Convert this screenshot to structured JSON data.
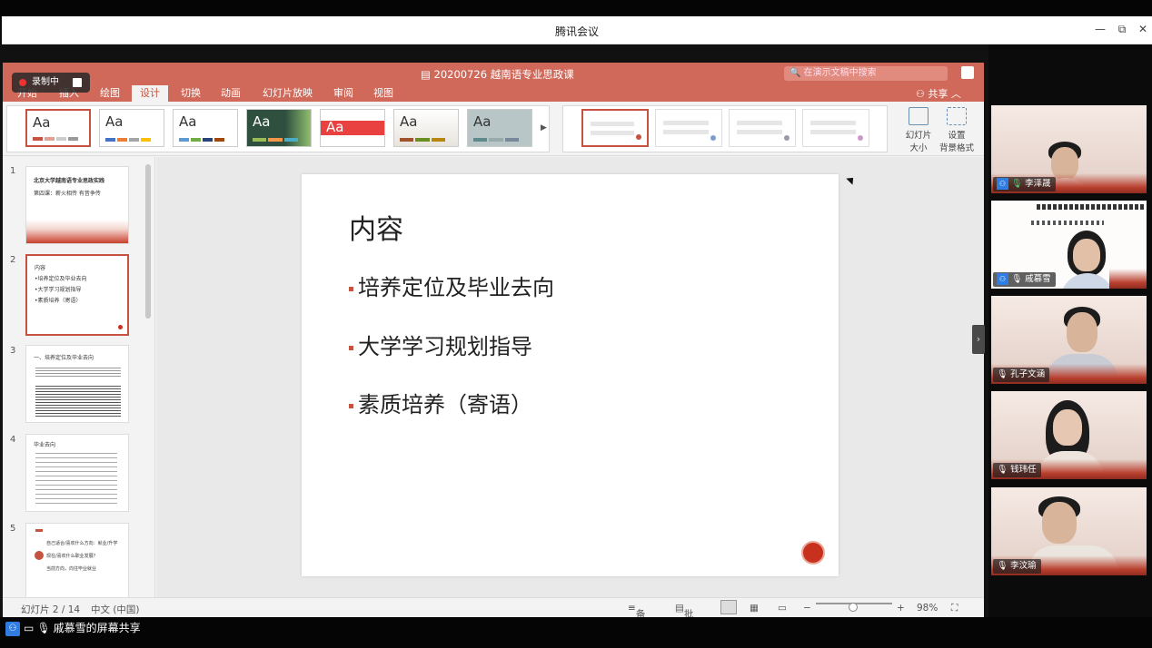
{
  "meeting": {
    "title": "腾讯会议"
  },
  "recording": {
    "label": "录制中"
  },
  "ppt": {
    "doc_title": "20200726 越南语专业思政课",
    "search_placeholder": "在演示文稿中搜索",
    "share_label": "共享",
    "tabs": [
      "开始",
      "插入",
      "绘图",
      "设计",
      "切换",
      "动画",
      "幻灯片放映",
      "审阅",
      "视图"
    ],
    "active_tab": "设计",
    "ribbon_buttons": {
      "slide_size": "幻灯片\n大小",
      "format_bg": "设置\n背景格式"
    },
    "theme_label": "Aa"
  },
  "thumbs": [
    {
      "num": "1",
      "lines": [
        "北京大学越南语专业思政实践",
        "第四课：薪火相传 有昔争传"
      ]
    },
    {
      "num": "2",
      "lines": [
        "内容",
        "•培养定位及毕业去向",
        "•大学学习规划指导",
        "•素质培养（寄语）"
      ]
    },
    {
      "num": "3",
      "lines": [
        "一、培养定位及毕业去向"
      ]
    },
    {
      "num": "4",
      "lines": [
        "毕业去向"
      ]
    },
    {
      "num": "5",
      "lines": [
        "自己适合/喜欢什么方向：就业/升学",
        "现在/喜欢什么职业发展？",
        "当前方向，向往毕业就业"
      ]
    }
  ],
  "slide": {
    "heading": "内容",
    "bullets": [
      "培养定位及毕业去向",
      "大学学习规划指导",
      "素质培养（寄语）"
    ]
  },
  "status": {
    "slide_count": "幻灯片 2 / 14",
    "language": "中文 (中国)",
    "notes": "备注",
    "comments": "批注",
    "zoom": "98%"
  },
  "participants": [
    {
      "name": "李泽晟"
    },
    {
      "name": "戚慕雪"
    },
    {
      "name": "孔子文涵"
    },
    {
      "name": "钱玮任"
    },
    {
      "name": "李汶瑜"
    }
  ],
  "bottom": {
    "share_text": "戚慕雪的屏幕共享"
  },
  "colors": {
    "ribbon": "#d0695a",
    "accent": "#c5533f"
  }
}
